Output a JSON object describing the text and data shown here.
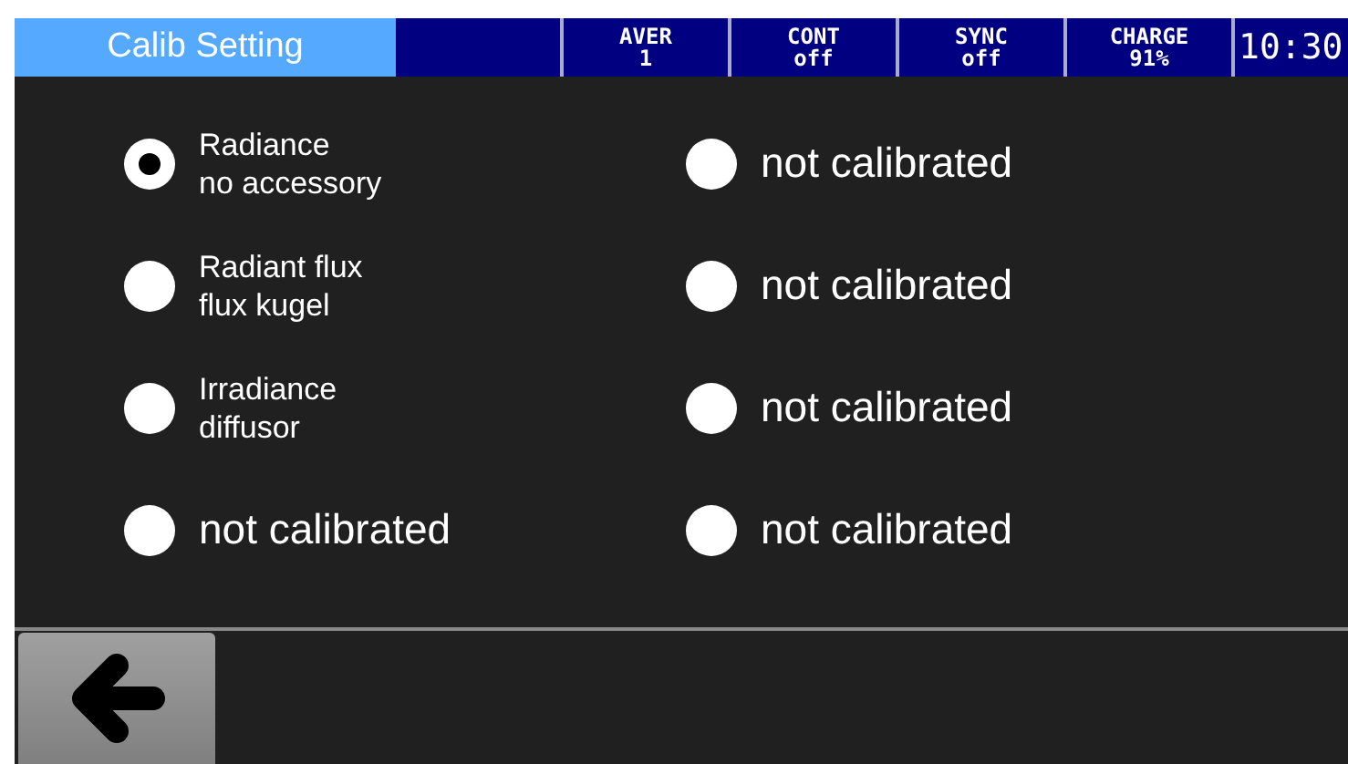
{
  "title": "Calib Setting",
  "status": [
    {
      "label": "AVER",
      "value": "1"
    },
    {
      "label": "CONT",
      "value": "off"
    },
    {
      "label": "SYNC",
      "value": "off"
    },
    {
      "label": "CHARGE",
      "value": "91%"
    }
  ],
  "time": "10:30",
  "options": [
    {
      "lines": [
        "Radiance",
        "no accessory"
      ],
      "selected": true
    },
    {
      "lines": [
        "not calibrated"
      ],
      "selected": false
    },
    {
      "lines": [
        "Radiant flux",
        "flux kugel"
      ],
      "selected": false
    },
    {
      "lines": [
        "not calibrated"
      ],
      "selected": false
    },
    {
      "lines": [
        "Irradiance",
        "diffusor"
      ],
      "selected": false
    },
    {
      "lines": [
        "not calibrated"
      ],
      "selected": false
    },
    {
      "lines": [
        "not calibrated"
      ],
      "selected": false
    },
    {
      "lines": [
        "not calibrated"
      ],
      "selected": false
    }
  ]
}
